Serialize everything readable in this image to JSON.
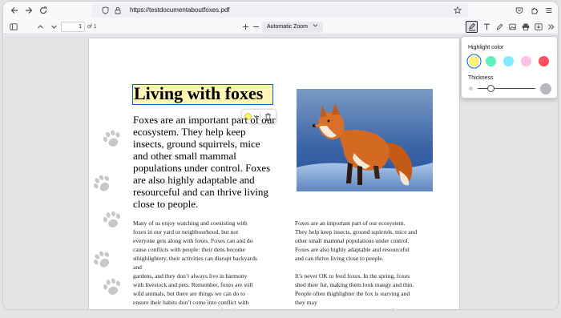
{
  "browser": {
    "url": "https://testdocumentaboutfoxes.pdf",
    "icons": [
      "back-icon",
      "forward-icon",
      "reload-icon",
      "shield-icon",
      "lock-icon",
      "star-icon",
      "pocket-icon",
      "extensions-icon",
      "menu-icon"
    ]
  },
  "pdf_toolbar": {
    "page_number": "1",
    "page_count": "of 1",
    "zoom": "Automatic Zoom",
    "icons": [
      "sidebar-toggle-icon",
      "previous-page-icon",
      "next-page-icon",
      "zoom-in-icon",
      "zoom-out-icon",
      "highlight-icon",
      "text-icon",
      "draw-icon",
      "image-icon",
      "print-icon",
      "save-icon",
      "more-tools-icon"
    ]
  },
  "document": {
    "title": "Living with foxes",
    "intro": "Foxes are an important part of our ecosystem. They help keep insects, ground squirrels, mice and other small mammal populations under control. Foxes are also highly adaptable and resourceful and can thrive living close to people.",
    "column1": "Many of us enjoy watching and coexisting with\nfoxes in our yard or neighbourhood, but not\neveryone gets along with foxes. Foxes can and do\ncause conflicts with people: their dens become\nsthighlightery, their activities can disrupt backyards\nand\ngardens, and they don’t always live in harmony\nwith livestock and pets. Remember, foxes are still\nwild animals, but there are things we can do to\nensure their habits don’t come into conflict with\nour own. We can still enjoy the benefits of",
    "column2": "Foxes are an important part of our ecosystem.\nThey help keep insects, ground squirrels, mice and\nother small mammal populations under control.\nFoxes are also highly adaptable and resourceful\nand can thrive living close to people.\n\nIt’s never OK to feed foxes. In the spring, foxes\nshed their fur, making them look mangy and thin.\nPeople often thighlighter the fox is starving and\nthey may\nchoose to “help it along.” However, the fox is likely"
  },
  "highlight_popup": {
    "color_label": "Highlight color",
    "thickness_label": "Thickness",
    "colors": [
      "#fff176",
      "#5ef0b8",
      "#80ebff",
      "#ffc1e3",
      "#ff4f5e"
    ],
    "selected_color": "#fff176"
  },
  "colors": {
    "accent": "#0060df",
    "highlight": "#fff5b4"
  }
}
